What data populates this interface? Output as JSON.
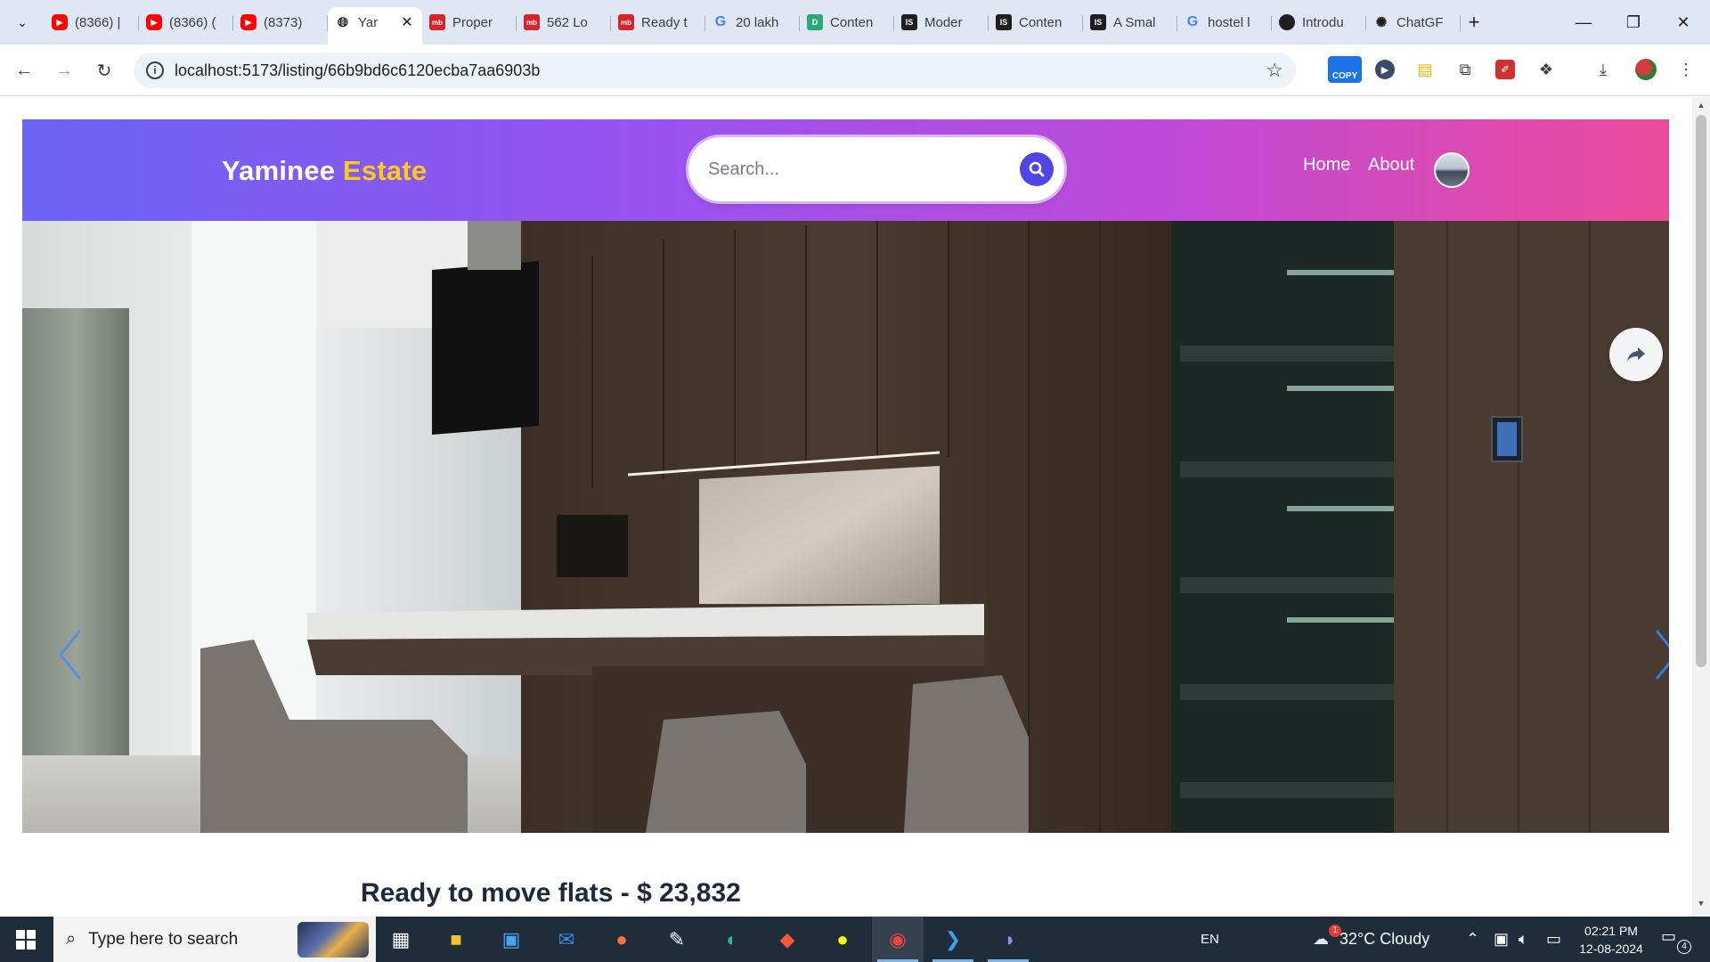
{
  "browser": {
    "tabs": [
      {
        "label": "(8366) |",
        "favicon": "youtube-icon"
      },
      {
        "label": "(8366) (",
        "favicon": "youtube-icon"
      },
      {
        "label": "(8373) ",
        "favicon": "youtube-icon"
      },
      {
        "label": "Yar",
        "favicon": "globe-icon",
        "active": true
      },
      {
        "label": "Proper",
        "favicon": "mb-icon",
        "favicon_text": "mb"
      },
      {
        "label": "562 Lo",
        "favicon": "mb-icon",
        "favicon_text": "mb"
      },
      {
        "label": "Ready t",
        "favicon": "mb-icon",
        "favicon_text": "mb"
      },
      {
        "label": "20 lakh",
        "favicon": "google-icon",
        "favicon_text": "G"
      },
      {
        "label": "Conten",
        "favicon": "dj-icon",
        "favicon_text": "D"
      },
      {
        "label": "Moder",
        "favicon": "is-icon",
        "favicon_text": "IS"
      },
      {
        "label": "Conten",
        "favicon": "is-icon",
        "favicon_text": "IS"
      },
      {
        "label": "A Smal",
        "favicon": "is-icon",
        "favicon_text": "IS"
      },
      {
        "label": "hostel l",
        "favicon": "google-icon",
        "favicon_text": "G"
      },
      {
        "label": "Introdu",
        "favicon": "intro-icon",
        "favicon_text": ""
      },
      {
        "label": "ChatGF",
        "favicon": "chatgpt-icon",
        "favicon_text": "✺"
      }
    ],
    "address": "localhost:5173/listing/66b9bd6c6120ecba7aa6903b",
    "extensions": {
      "copy_label": "COPY"
    }
  },
  "site": {
    "logo_primary": "Yaminee",
    "logo_accent": "Estate",
    "search_placeholder": "Search...",
    "nav": {
      "home": "Home",
      "about": "About"
    },
    "colors": {
      "header_start": "#6b63f6",
      "header_end": "#ec4a99",
      "logo_accent": "#facc15",
      "search_button": "#4f46e5"
    }
  },
  "listing": {
    "title": "Ready to move flats - $ 23,832"
  },
  "taskbar": {
    "search_placeholder": "Type here to search",
    "language": "EN",
    "weather": "32°C  Cloudy",
    "weather_badge": "1",
    "time": "02:21 PM",
    "date": "12-08-2024",
    "notifications": "4"
  }
}
